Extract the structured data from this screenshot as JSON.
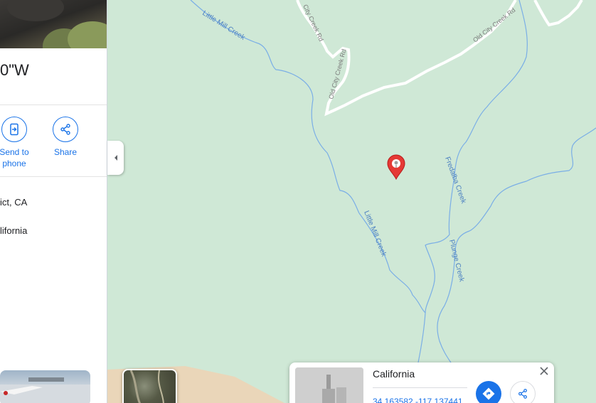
{
  "panel": {
    "coord_title_fragment": "0\"W",
    "actions": [
      {
        "label": "Send to phone",
        "icon": "send-to-phone-icon"
      },
      {
        "label": "Share",
        "icon": "share-icon"
      }
    ],
    "info_lines": [
      "ict, CA",
      "lifornia"
    ]
  },
  "map": {
    "roads": [
      {
        "name": "Old City Creek Rd"
      },
      {
        "name": "Old City Creek Rd"
      },
      {
        "name": "Old City Creek Rd"
      }
    ],
    "streams": [
      {
        "name": "Little Mill Creek"
      },
      {
        "name": "Little Mill Creek"
      },
      {
        "name": "Fredalba Creek"
      },
      {
        "name": "Plunge Creek"
      }
    ],
    "labels": {
      "road_top": "City Creek Rd",
      "road_mid": "Old City Creek Rd",
      "road_right": "Old City Creek Rd",
      "creek_top": "Little Mill Creek",
      "creek_mid": "Little Mill Creek",
      "creek_fredalba": "Fredalba Creek",
      "creek_plunge": "Plunge Creek"
    },
    "colors": {
      "terrain": "#cfe8d6",
      "water": "#7aaee6",
      "road": "#ffffff",
      "pin": "#e53935"
    }
  },
  "place_card": {
    "title": "California",
    "coords": "34.163582,-117.137441"
  }
}
